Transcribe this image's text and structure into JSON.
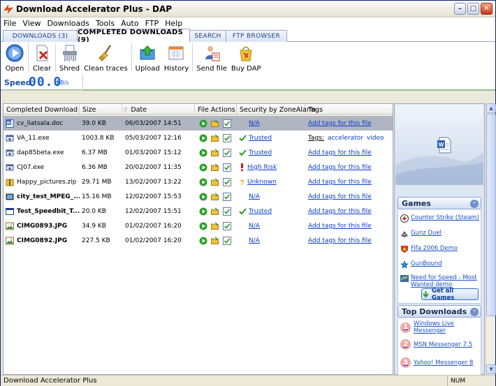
{
  "window": {
    "title": "Download Accelerator Plus - DAP"
  },
  "menu": [
    "File",
    "View",
    "Downloads",
    "Tools",
    "Auto",
    "FTP",
    "Help"
  ],
  "tabs": [
    {
      "label": "DOWNLOADS (3)",
      "active": false
    },
    {
      "label": "COMPLETED DOWNLOADS (9)",
      "active": true
    },
    {
      "label": "SEARCH",
      "active": false
    },
    {
      "label": "FTP BROWSER",
      "active": false
    }
  ],
  "toolbar": [
    {
      "label": "Open",
      "icon": "open-icon"
    },
    {
      "label": "Clear",
      "icon": "clear-icon"
    },
    {
      "label": "Shred",
      "icon": "shred-icon"
    },
    {
      "label": "Clean traces",
      "icon": "broom-icon"
    },
    {
      "label": "Upload",
      "icon": "upload-icon"
    },
    {
      "label": "History",
      "icon": "history-icon"
    },
    {
      "label": "Send file",
      "icon": "send-file-icon"
    },
    {
      "label": "Buy DAP",
      "icon": "buy-icon"
    }
  ],
  "speed": {
    "label": "Speed",
    "value": "00.0",
    "unit": "KB/s"
  },
  "columns": [
    "Completed Download",
    "Size",
    "Date",
    "File Actions",
    "Security by ZoneAlarm",
    "Tags"
  ],
  "rows": [
    {
      "name": "cv_liatsala.doc",
      "size": "39.0 KB",
      "date": "06/03/2007 14:51",
      "security": "N/A",
      "secIcon": "none",
      "tags": "Add tags for this file",
      "bold": false,
      "selected": true,
      "icon": "word"
    },
    {
      "name": "VA_11.exe",
      "size": "1003.8 KB",
      "date": "05/03/2007 12:16",
      "security": "Trusted",
      "secIcon": "check",
      "tagsLabel": "Tags:",
      "tagValues": [
        "accelerator",
        "video"
      ],
      "bold": false,
      "selected": false,
      "icon": "exe"
    },
    {
      "name": "dap85beta.exe",
      "size": "6.37 MB",
      "date": "01/03/2007 15:12",
      "security": "Trusted",
      "secIcon": "check",
      "tags": "Add tags for this file",
      "bold": false,
      "selected": false,
      "icon": "exe"
    },
    {
      "name": "CJ07.exe",
      "size": "6.36 MB",
      "date": "20/02/2007 11:35",
      "security": "High Risk",
      "secIcon": "alert",
      "tags": "Add tags for this file",
      "bold": false,
      "selected": false,
      "icon": "exe"
    },
    {
      "name": "Happy_pictures.zip",
      "size": "29.71 MB",
      "date": "13/02/2007 13:22",
      "security": "Unknown",
      "secIcon": "question",
      "tags": "Add tags for this file",
      "bold": false,
      "selected": false,
      "icon": "zip"
    },
    {
      "name": "city_test_MPEG_...",
      "size": "15.16 MB",
      "date": "12/02/2007 15:53",
      "security": "N/A",
      "secIcon": "none",
      "tags": "Add tags for this file",
      "bold": true,
      "selected": false,
      "icon": "video"
    },
    {
      "name": "Test_Speedbit_T...",
      "size": "20.0 KB",
      "date": "12/02/2007 15:51",
      "security": "Trusted",
      "secIcon": "check",
      "tags": "Add tags for this file",
      "bold": true,
      "selected": false,
      "icon": "window"
    },
    {
      "name": "CIMG0893.JPG",
      "size": "34.9 KB",
      "date": "01/02/2007 16:20",
      "security": "N/A",
      "secIcon": "none",
      "tags": "Add tags for this file",
      "bold": true,
      "selected": false,
      "icon": "image"
    },
    {
      "name": "CIMG0892.JPG",
      "size": "227.5 KB",
      "date": "01/02/2007 16:20",
      "security": "N/A",
      "secIcon": "none",
      "tags": "Add tags for this file",
      "bold": true,
      "selected": false,
      "icon": "image"
    }
  ],
  "sidebar": {
    "games_title": "Games",
    "games": [
      "Counter Strike (Steam)",
      "Gunz Duel",
      "Fifa 2006 Demo",
      "GunBound",
      "Need for Speed - Most Wanted demo"
    ],
    "get_all": "Get all Games",
    "top_title": "Top Downloads",
    "top": [
      "Windows Live Messenger",
      "MSN Messenger 7.5",
      "Yahoo! Messenger 8"
    ]
  },
  "status": {
    "text": "Download Accelerator Plus",
    "num": "NUM"
  },
  "colors": {
    "selection": "#b1b5c2",
    "link": "#0a3ec9",
    "speed": "#1b5ec9"
  }
}
